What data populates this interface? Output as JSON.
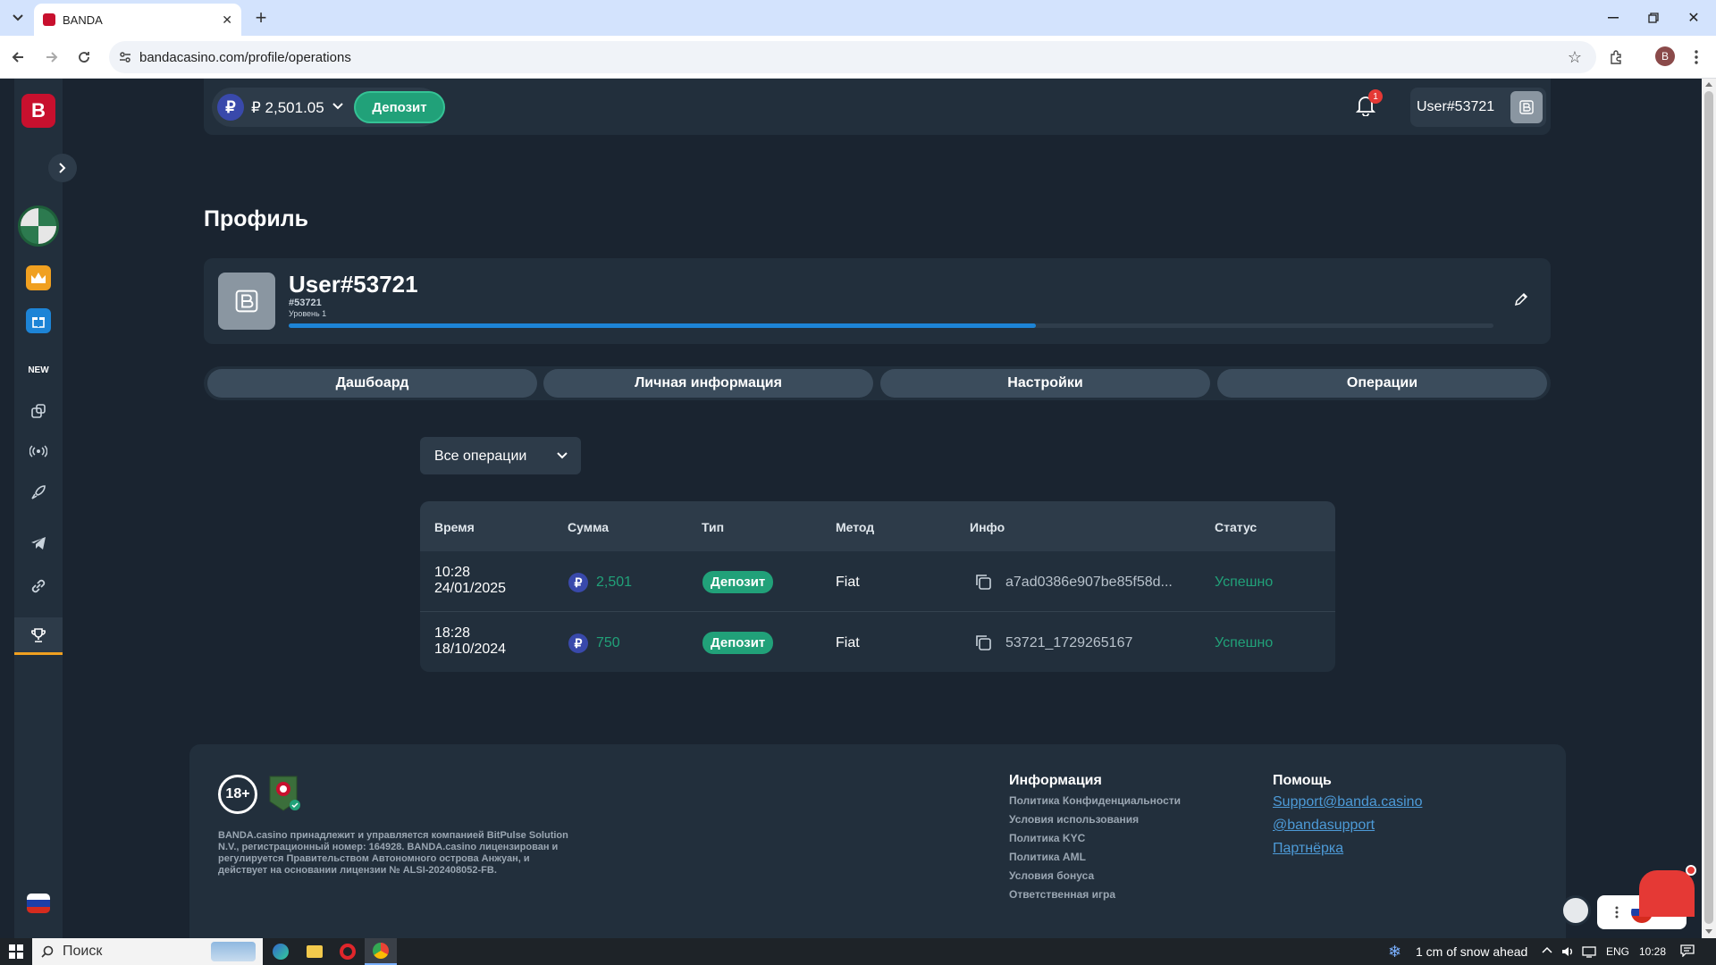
{
  "browser": {
    "tab_title": "BANDA",
    "url": "bandacasino.com/profile/operations",
    "profile_initial": "B"
  },
  "topbar": {
    "currency_symbol": "₽",
    "balance": "₽ 2,501.05",
    "deposit_label": "Депозит",
    "notification_count": "1",
    "username": "User#53721"
  },
  "sidebar": {
    "logo": "B",
    "new_label": "NEW"
  },
  "profile": {
    "page_title": "Профиль",
    "username": "User#53721",
    "user_id": "#53721",
    "level_label": "Уровень 1",
    "level_progress": 0.62
  },
  "tabs": [
    {
      "label": "Дашбоард"
    },
    {
      "label": "Личная информация"
    },
    {
      "label": "Настройки"
    },
    {
      "label": "Операции"
    }
  ],
  "filter": {
    "selected": "Все операции"
  },
  "operations": {
    "headers": [
      "Время",
      "Сумма",
      "Тип",
      "Метод",
      "Инфо",
      "Статус"
    ],
    "rows": [
      {
        "time": "10:28",
        "date": "24/01/2025",
        "amount": "2,501",
        "type": "Депозит",
        "method": "Fiat",
        "info": "a7ad0386e907be85f58d...",
        "status": "Успешно"
      },
      {
        "time": "18:28",
        "date": "18/10/2024",
        "amount": "750",
        "type": "Депозит",
        "method": "Fiat",
        "info": "53721_1729265167",
        "status": "Успешно"
      }
    ]
  },
  "footer": {
    "age_badge": "18+",
    "legal_text": "BANDA.casino принадлежит и управляется компанией BitPulse Solution N.V., регистрационный номер: 164928. BANDA.casino лицензирован и регулируется Правительством Автономного острова Анжуан, и действует на основании лицензии № ALSI-202408052-FB.",
    "info_title": "Информация",
    "info_links": [
      "Политика Конфиденциальности",
      "Условия использования",
      "Политика KYC",
      "Политика AML",
      "Условия бонуса",
      "Ответственная игра"
    ],
    "help_title": "Помощь",
    "help_links": [
      "Support@banda.casino",
      "@bandasupport",
      "Партнёрка"
    ]
  },
  "taskbar": {
    "search_placeholder": "Поиск",
    "weather": "1 cm of snow ahead",
    "lang": "ENG",
    "time": "10:28"
  },
  "colors": {
    "accent_green": "#21a179",
    "page_bg": "#1a2430",
    "panel_bg": "#222f3c",
    "progress_blue": "#1d84d6"
  }
}
